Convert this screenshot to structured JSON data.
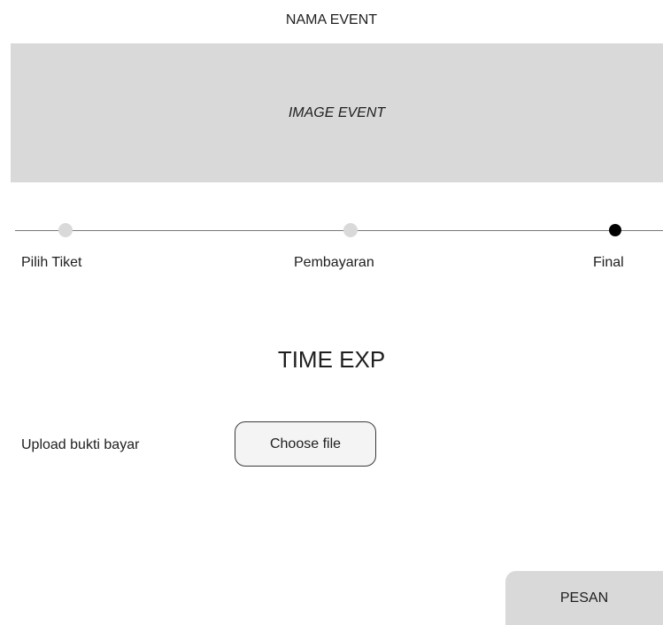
{
  "event": {
    "title": "NAMA EVENT",
    "image_label": "IMAGE EVENT"
  },
  "stepper": {
    "steps": [
      {
        "label": "Pilih Tiket",
        "state": "inactive"
      },
      {
        "label": "Pembayaran",
        "state": "inactive"
      },
      {
        "label": "Final",
        "state": "active"
      }
    ]
  },
  "timer": {
    "label": "TIME EXP"
  },
  "upload": {
    "label": "Upload bukti bayar",
    "button_label": "Choose file"
  },
  "actions": {
    "submit_label": "PESAN"
  },
  "colors": {
    "placeholder_gray": "#d9d9d9",
    "active_step": "#000000",
    "text": "#1e1e1e"
  }
}
